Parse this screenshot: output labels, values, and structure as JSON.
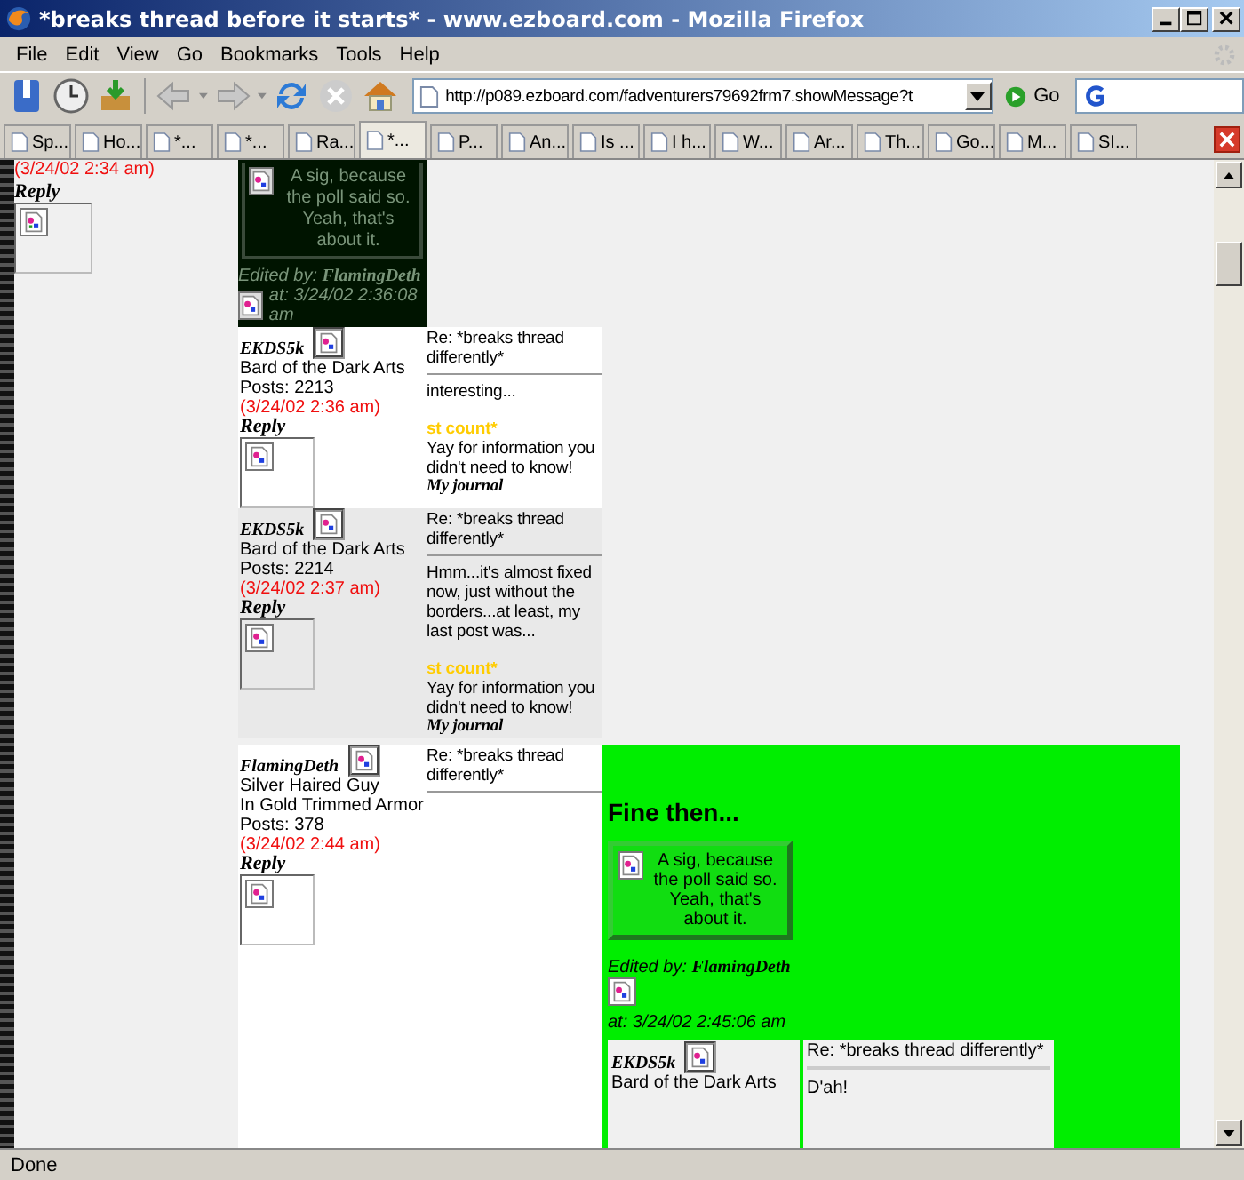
{
  "window": {
    "title": "*breaks thread before it starts* - www.ezboard.com - Mozilla Firefox"
  },
  "menu": [
    "File",
    "Edit",
    "View",
    "Go",
    "Bookmarks",
    "Tools",
    "Help"
  ],
  "address": {
    "url": "http://p089.ezboard.com/fadventurers79692frm7.showMessage?t",
    "go": "Go"
  },
  "tabs": [
    {
      "label": "Sp...",
      "selected": false
    },
    {
      "label": "Ho...",
      "selected": false
    },
    {
      "label": "*...",
      "selected": false
    },
    {
      "label": "*...",
      "selected": false
    },
    {
      "label": "Ra...",
      "selected": false
    },
    {
      "label": "*...",
      "selected": true
    },
    {
      "label": "P...",
      "selected": false
    },
    {
      "label": "An...",
      "selected": false
    },
    {
      "label": "Is ...",
      "selected": false
    },
    {
      "label": "I h...",
      "selected": false
    },
    {
      "label": "W...",
      "selected": false
    },
    {
      "label": "Ar...",
      "selected": false
    },
    {
      "label": "Th...",
      "selected": false
    },
    {
      "label": "Go...",
      "selected": false
    },
    {
      "label": "M...",
      "selected": false
    },
    {
      "label": "SI...",
      "selected": false
    }
  ],
  "left_column": {
    "date": "(3/24/02 2:34 am)",
    "reply": "Reply"
  },
  "dark_signature": {
    "sig_text": "A sig, because the poll said so. Yeah, that's about it.",
    "edited_label": "Edited by:",
    "edited_by": "FlamingDeth",
    "edited_at": "at: 3/24/02 2:36:08 am"
  },
  "posts": [
    {
      "kind": "text",
      "highlighted": true,
      "author": "EKDS5k",
      "title": [
        "Bard of the Dark Arts"
      ],
      "post_count": "Posts: 2213",
      "date": "(3/24/02 2:36 am)",
      "reply": "Reply",
      "subject": "Re: *breaks thread differently*",
      "body": "interesting...",
      "sig_title": "st count*",
      "sig_text": "Yay for information you didn't need to know!",
      "sig_link": "My journal"
    },
    {
      "kind": "text",
      "highlighted": false,
      "author": "EKDS5k",
      "title": [
        "Bard of the Dark Arts"
      ],
      "post_count": "Posts: 2214",
      "date": "(3/24/02 2:37 am)",
      "reply": "Reply",
      "subject": "Re: *breaks thread differently*",
      "body": "Hmm...it's almost fixed now, just without the borders...at least, my last post was...",
      "sig_title": "st count*",
      "sig_text": "Yay for information you didn't need to know!",
      "sig_link": "My journal"
    },
    {
      "kind": "green",
      "highlighted": true,
      "author": "FlamingDeth",
      "title": [
        "Silver Haired Guy",
        "In Gold Trimmed Armor"
      ],
      "post_count": "Posts: 378",
      "date": "(3/24/02 2:44 am)",
      "reply": "Reply",
      "subject": "Re: *breaks thread differently*",
      "heading": "Fine then...",
      "sig_text": "A sig, because the poll said so. Yeah, that's about it.",
      "edited_label": "Edited by:",
      "edited_by": "FlamingDeth",
      "edited_at": "at: 3/24/02 2:45:06 am",
      "nested": {
        "author": "EKDS5k",
        "title": "Bard of the Dark Arts",
        "subject": "Re: *breaks thread differently*",
        "body": "D'ah!"
      }
    }
  ],
  "status_bar": "Done"
}
